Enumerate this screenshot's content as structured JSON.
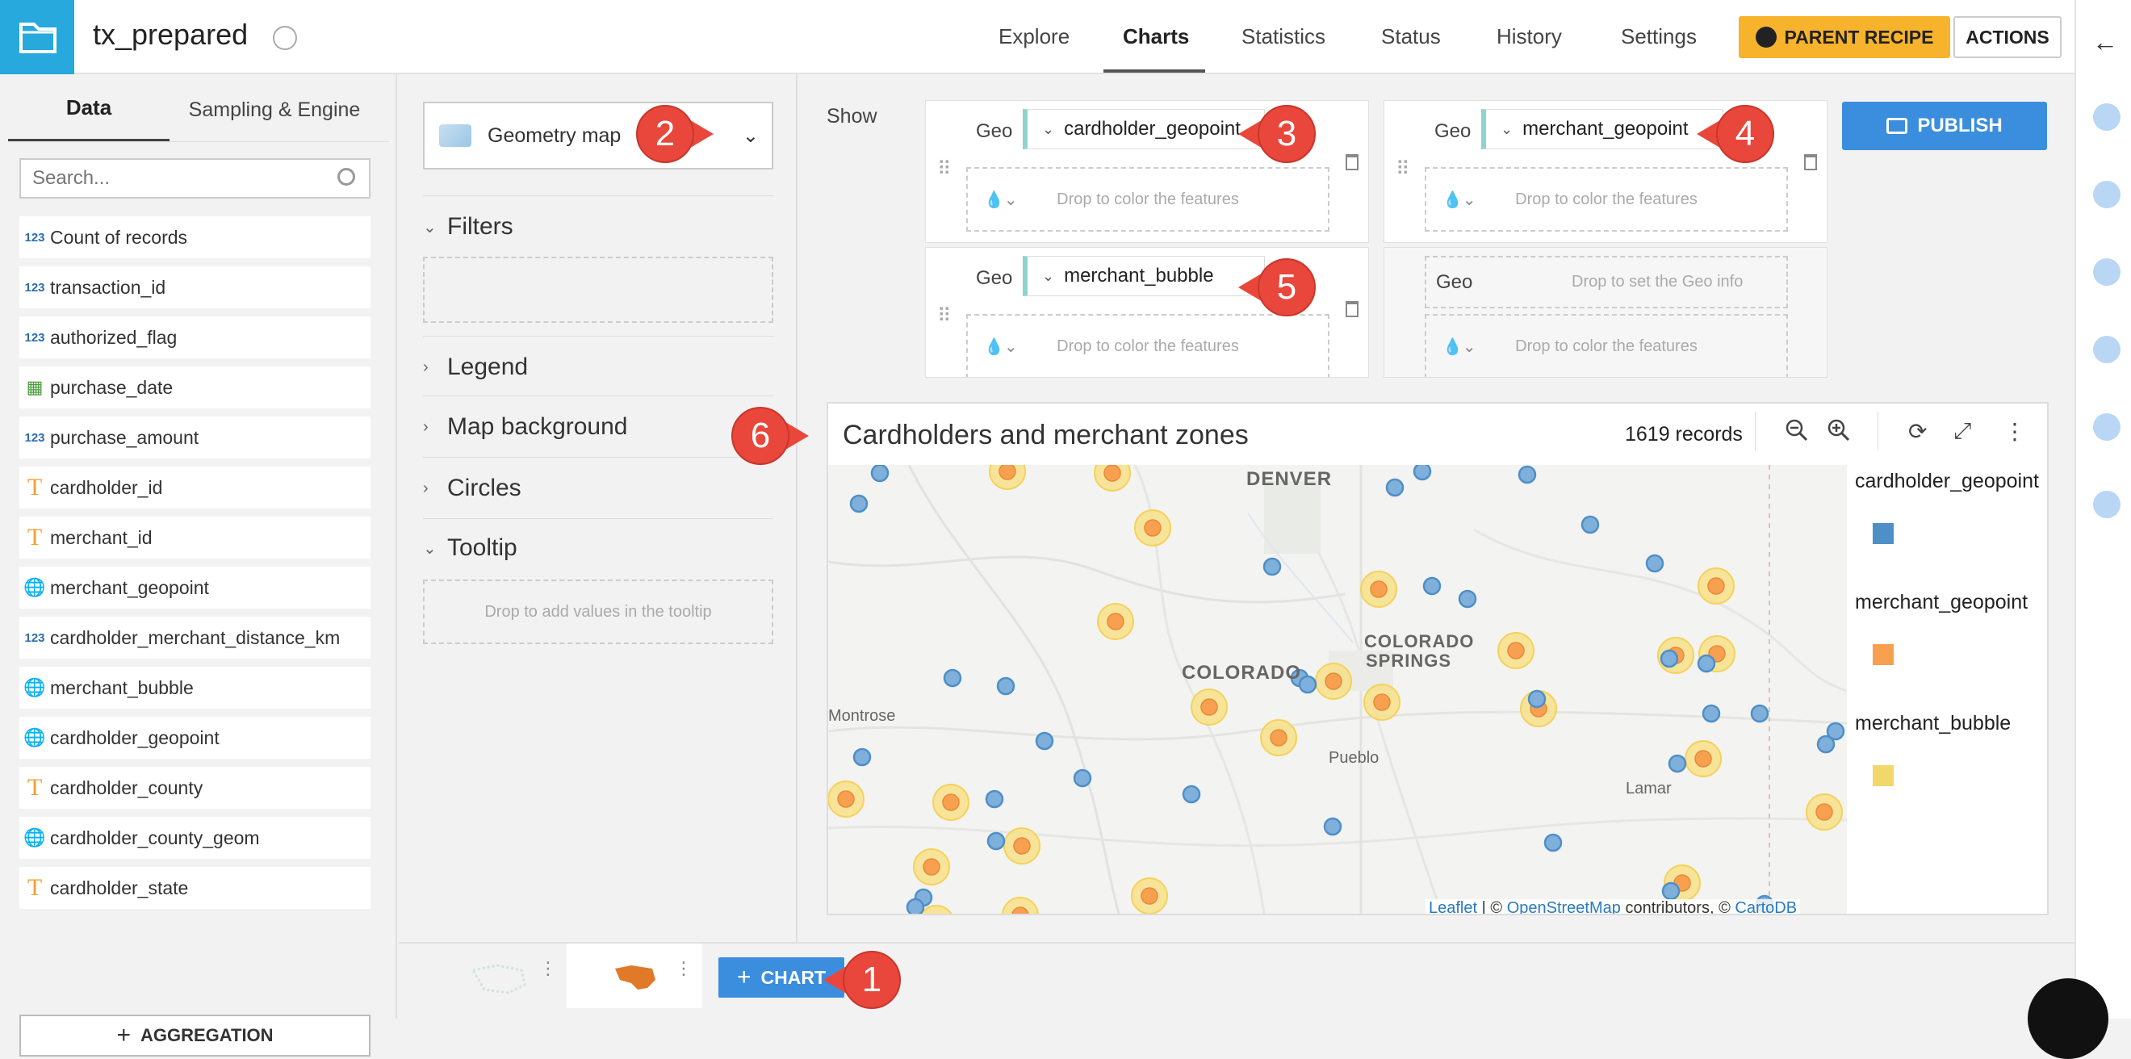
{
  "header": {
    "title": "tx_prepared",
    "nav": [
      "Explore",
      "Charts",
      "Statistics",
      "Status",
      "History",
      "Settings"
    ],
    "active_nav": "Charts",
    "parent_recipe": "PARENT RECIPE",
    "actions": "ACTIONS"
  },
  "left_panel": {
    "tabs": [
      "Data",
      "Sampling & Engine"
    ],
    "search_placeholder": "Search...",
    "columns": [
      {
        "type": "123",
        "name": "Count of records"
      },
      {
        "type": "123",
        "name": "transaction_id"
      },
      {
        "type": "123",
        "name": "authorized_flag"
      },
      {
        "type": "date",
        "name": "purchase_date"
      },
      {
        "type": "123",
        "name": "purchase_amount"
      },
      {
        "type": "T",
        "name": "cardholder_id"
      },
      {
        "type": "T",
        "name": "merchant_id"
      },
      {
        "type": "geo",
        "name": "merchant_geopoint"
      },
      {
        "type": "123",
        "name": "cardholder_merchant_distance_km"
      },
      {
        "type": "geo",
        "name": "merchant_bubble"
      },
      {
        "type": "geo",
        "name": "cardholder_geopoint"
      },
      {
        "type": "T",
        "name": "cardholder_county"
      },
      {
        "type": "geo",
        "name": "cardholder_county_geom"
      },
      {
        "type": "T",
        "name": "cardholder_state"
      }
    ],
    "aggregation_btn": "AGGREGATION"
  },
  "mid_panel": {
    "chart_type": "Geometry map",
    "sections": {
      "filters": "Filters",
      "legend": "Legend",
      "map_background": "Map background",
      "circles": "Circles",
      "tooltip": "Tooltip"
    },
    "tooltip_drop": "Drop to add values in the tooltip"
  },
  "dims": {
    "show_label": "Show",
    "geo_label": "Geo",
    "color_drop": "Drop to color the features",
    "geo_drop": "Drop to set the Geo info",
    "layer1": "cardholder_geopoint",
    "layer2": "merchant_geopoint",
    "layer3": "merchant_bubble"
  },
  "publish_btn": "PUBLISH",
  "chart": {
    "title": "Cardholders and merchant zones",
    "records": "1619 records",
    "places": {
      "denver": "DENVER",
      "colorado": "COLORADO",
      "co_springs1": "COLORADO",
      "co_springs2": "SPRINGS",
      "montrose": "Montrose",
      "pueblo": "Pueblo",
      "lamar": "Lamar"
    },
    "attribution": {
      "leaflet": "Leaflet",
      "sep": "|",
      "copy1": "©",
      "osm": "OpenStreetMap",
      "contrib": "contributors, ©",
      "carto": "CartoDB"
    },
    "legend": [
      {
        "label": "cardholder_geopoint",
        "color": "#4f8fc7"
      },
      {
        "label": "merchant_geopoint",
        "color": "#f7a050"
      },
      {
        "label": "merchant_bubble",
        "color": "#f2d86a"
      }
    ]
  },
  "bottom": {
    "chart_btn": "CHART"
  },
  "callouts": {
    "c1": "1",
    "c2": "2",
    "c3": "3",
    "c4": "4",
    "c5": "5",
    "c6": "6"
  }
}
